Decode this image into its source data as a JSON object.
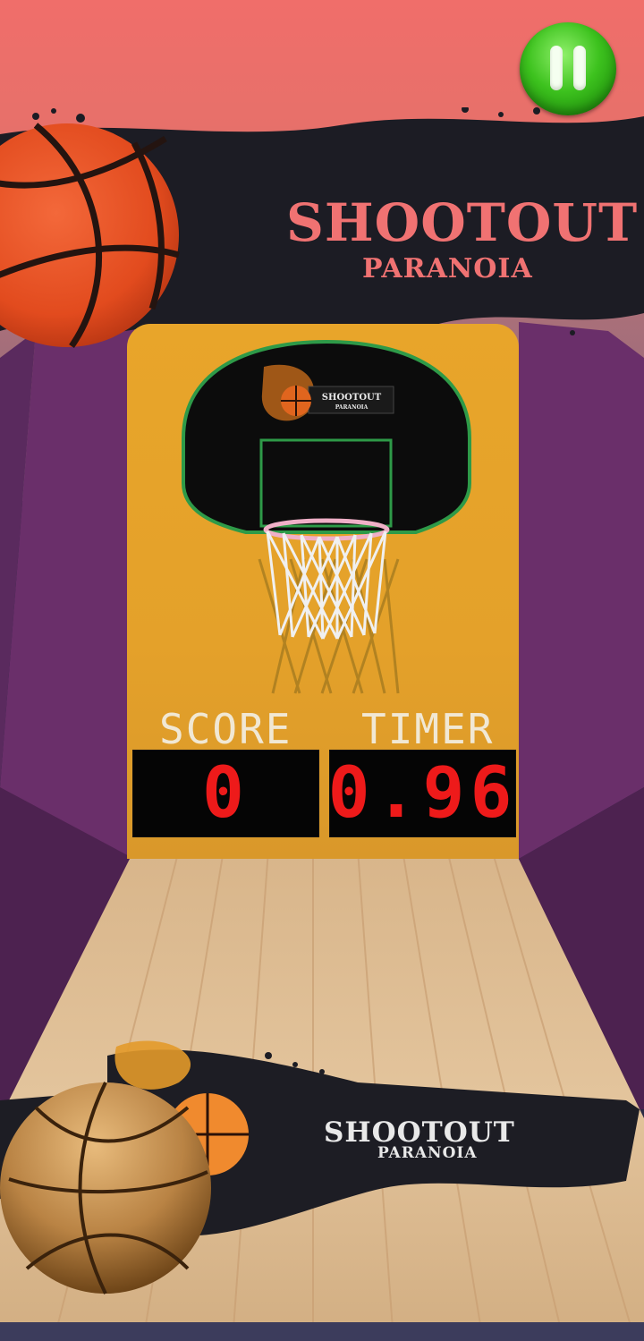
{
  "header": {
    "title": "SHOOTOUT",
    "subtitle": "PARANOIA",
    "pause_icon": "pause-icon"
  },
  "backboard": {
    "logo_title": "SHOOTOUT",
    "logo_subtitle": "PARANOIA"
  },
  "scoreboard": {
    "score_label": "SCORE",
    "timer_label": "TIMER",
    "score_value": "0",
    "timer_value": "0.96"
  },
  "footer_banner": {
    "title": "SHOOTOUT",
    "subtitle": "PARANOIA"
  },
  "colors": {
    "title": "#f07272",
    "digits": "#ee1a1a",
    "pause_button": "#3dc21e",
    "panel": "#e4a12a"
  }
}
